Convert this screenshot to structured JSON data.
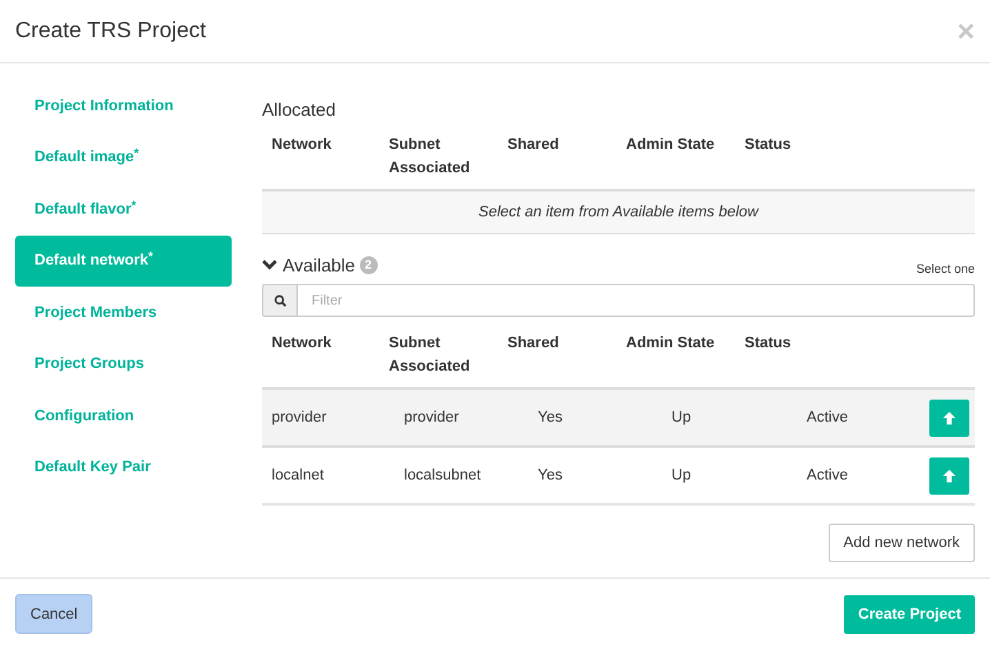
{
  "dialog": {
    "title": "Create TRS Project",
    "close": "×"
  },
  "sidebar": {
    "items": [
      {
        "label": "Project Information",
        "selected": false
      },
      {
        "label": "Default image$^{*}$",
        "selected": false
      },
      {
        "label": "Default flavor$^{*}$",
        "selected": false
      },
      {
        "label": "Default network$^{*}$",
        "selected": true
      },
      {
        "label": "Project Members",
        "selected": false
      },
      {
        "label": "Project Groups",
        "selected": false
      },
      {
        "label": "Configuration",
        "selected": false
      },
      {
        "label": "Default Key Pair",
        "selected": false
      }
    ]
  },
  "allocated": {
    "title": "Allocated",
    "columns": [
      "Network",
      "Subnet Associated",
      "Shared",
      "Admin State",
      "Status"
    ],
    "empty_message": "Select an item from Available items below"
  },
  "available": {
    "title": "Available",
    "count": "2",
    "expanded": true,
    "hint": "Select one",
    "filter": {
      "placeholder": "Filter"
    },
    "columns": [
      "Network",
      "Subnet Associated",
      "Shared",
      "Admin State",
      "Status"
    ],
    "rows": [
      {
        "cells": [
          "provider",
          "provider",
          "Yes",
          "Up",
          "Active"
        ],
        "hovered": true
      },
      {
        "cells": [
          "localnet",
          "localsubnet",
          "Yes",
          "Up",
          "Active"
        ],
        "hovered": false
      }
    ],
    "add_button": "Add new network"
  },
  "footer": {
    "cancel": "Cancel",
    "submit": "Create Project"
  }
}
